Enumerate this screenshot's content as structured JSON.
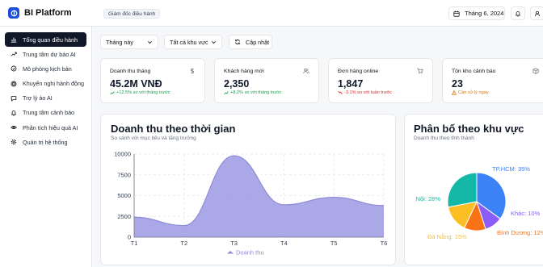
{
  "header": {
    "app_name": "BI Platform",
    "role_badge": "Giám đốc điều hành",
    "date": "Tháng 6, 2024"
  },
  "sidebar": {
    "items": [
      {
        "label": "Tổng quan điều hành",
        "icon": "bar-chart-icon",
        "active": true
      },
      {
        "label": "Trung tâm dự báo AI",
        "icon": "trending-up-icon"
      },
      {
        "label": "Mô phỏng kịch bản",
        "icon": "sliders-icon"
      },
      {
        "label": "Khuyến nghị hành động",
        "icon": "target-icon"
      },
      {
        "label": "Trợ lý ảo AI",
        "icon": "message-icon"
      },
      {
        "label": "Trung tâm cảnh báo",
        "icon": "bell-icon"
      },
      {
        "label": "Phân tích hiệu quả AI",
        "icon": "eye-icon"
      },
      {
        "label": "Quản trị hệ thống",
        "icon": "gear-icon"
      }
    ]
  },
  "filters": {
    "period": "Tháng này",
    "region": "Tất cả khu vực",
    "refresh_label": "Cập nhật"
  },
  "kpis": [
    {
      "title": "Doanh thu tháng",
      "value": "45.2M VNĐ",
      "delta": "+12.5% so với tháng trước",
      "trend": "up",
      "icon": "dollar-icon"
    },
    {
      "title": "Khách hàng mới",
      "value": "2,350",
      "delta": "+8.2% so với tháng trước",
      "trend": "up",
      "icon": "users-icon"
    },
    {
      "title": "Đơn hàng online",
      "value": "1,847",
      "delta": "-3.1% so với tuần trước",
      "trend": "down",
      "icon": "cart-icon"
    },
    {
      "title": "Tồn kho cảnh báo",
      "value": "23",
      "delta": "Cần xử lý ngay",
      "trend": "warn",
      "icon": "box-icon"
    }
  ],
  "revenue_chart": {
    "title": "Doanh thu theo thời gian",
    "subtitle": "So sánh với mục tiêu và tăng trưởng",
    "legend": "Doanh thu"
  },
  "region_chart": {
    "title": "Phân bố theo khu vực",
    "subtitle": "Doanh thu theo tỉnh thành"
  },
  "colors": {
    "area": "#a7a3e6",
    "area_stroke": "#8f8ad6",
    "hcm": "#3b82f6",
    "other": "#8b5cf6",
    "binhduong": "#f97316",
    "danang": "#fbbf24",
    "hanoi": "#14b8a6"
  },
  "chart_data": [
    {
      "type": "area",
      "title": "Doanh thu theo thời gian",
      "x": [
        "T1",
        "T2",
        "T3",
        "T4",
        "T5",
        "T6"
      ],
      "series": [
        {
          "name": "Doanh thu",
          "values": [
            2400,
            1400,
            9800,
            3900,
            4800,
            3800
          ]
        }
      ],
      "yticks": [
        0,
        2500,
        5000,
        7500,
        10000
      ],
      "ylim": [
        0,
        10000
      ],
      "grid": true,
      "legend": "bottom"
    },
    {
      "type": "pie",
      "title": "Phân bố theo khu vực",
      "slices": [
        {
          "label": "TP.HCM",
          "value": 35,
          "display": "TP.HCM: 35%",
          "color": "#3b82f6"
        },
        {
          "label": "Khác",
          "value": 10,
          "display": "Khác: 10%",
          "color": "#8b5cf6"
        },
        {
          "label": "Bình Dương",
          "value": 12,
          "display": "Bình Dương: 12%",
          "color": "#f97316"
        },
        {
          "label": "Đà Nẵng",
          "value": 15,
          "display": "Đà Nẵng: 15%",
          "color": "#fbbf24"
        },
        {
          "label": "Hà Nội",
          "value": 28,
          "display": "Nội: 28%",
          "color": "#14b8a6"
        }
      ]
    }
  ]
}
